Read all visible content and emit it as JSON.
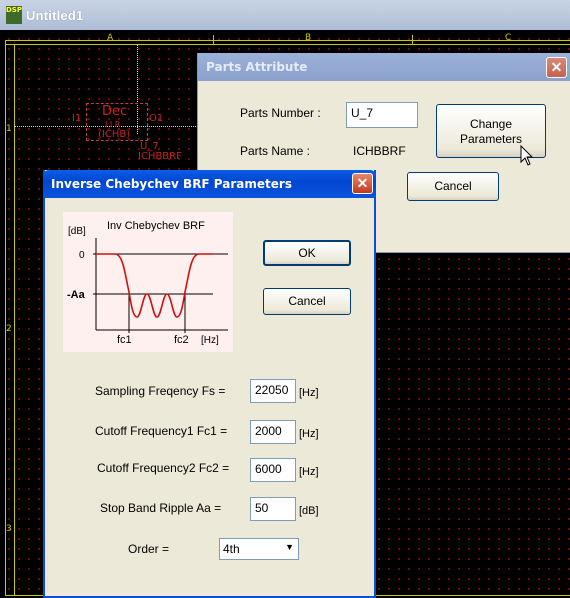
{
  "main_window": {
    "title": "Untitled1",
    "icon_text": "DSP",
    "column_labels": [
      "A",
      "B",
      "C"
    ],
    "row_labels": [
      "1",
      "2",
      "3"
    ],
    "component": {
      "ref_left": "I1",
      "ref_right": "O1",
      "symbol": "Dec",
      "symbol_sub": "I I R",
      "type_tag": "(ICHB)",
      "instance": "U_7",
      "part_name": "ICHBBRF"
    }
  },
  "parts_attribute": {
    "title": "Parts Attribute",
    "parts_number_label": "Parts Number :",
    "parts_number_value": "U_7",
    "parts_name_label": "Parts Name :",
    "parts_name_value": "ICHBBRF",
    "change_parameters_line1": "Change",
    "change_parameters_line2": "Parameters",
    "cancel_label": "Cancel",
    "close_glyph": "✕"
  },
  "inv_cheb_dialog": {
    "title": "Inverse Chebychev BRF Parameters",
    "close_glyph": "✕",
    "graph": {
      "title": "Inv Chebychev BRF",
      "y_unit": "[dB]",
      "y_zero": "0",
      "y_aa": "-Aa",
      "x_fc1": "fc1",
      "x_fc2": "fc2",
      "x_unit": "[Hz]",
      "curve_color": "#d01010",
      "axis_color": "#000000"
    },
    "ok_label": "OK",
    "cancel_label": "Cancel",
    "fields": [
      {
        "label": "Sampling Freqency Fs =",
        "value": "22050",
        "unit": "[Hz]"
      },
      {
        "label": "Cutoff Frequency1 Fc1 =",
        "value": "2000",
        "unit": "[Hz]"
      },
      {
        "label": "Cutoff Frequency2 Fc2 =",
        "value": "6000",
        "unit": "[Hz]"
      },
      {
        "label": "Stop Band Ripple Aa =",
        "value": "50",
        "unit": "[dB]"
      }
    ],
    "order_label": "Order =",
    "order_value": "4th",
    "order_arrow": "▼"
  }
}
